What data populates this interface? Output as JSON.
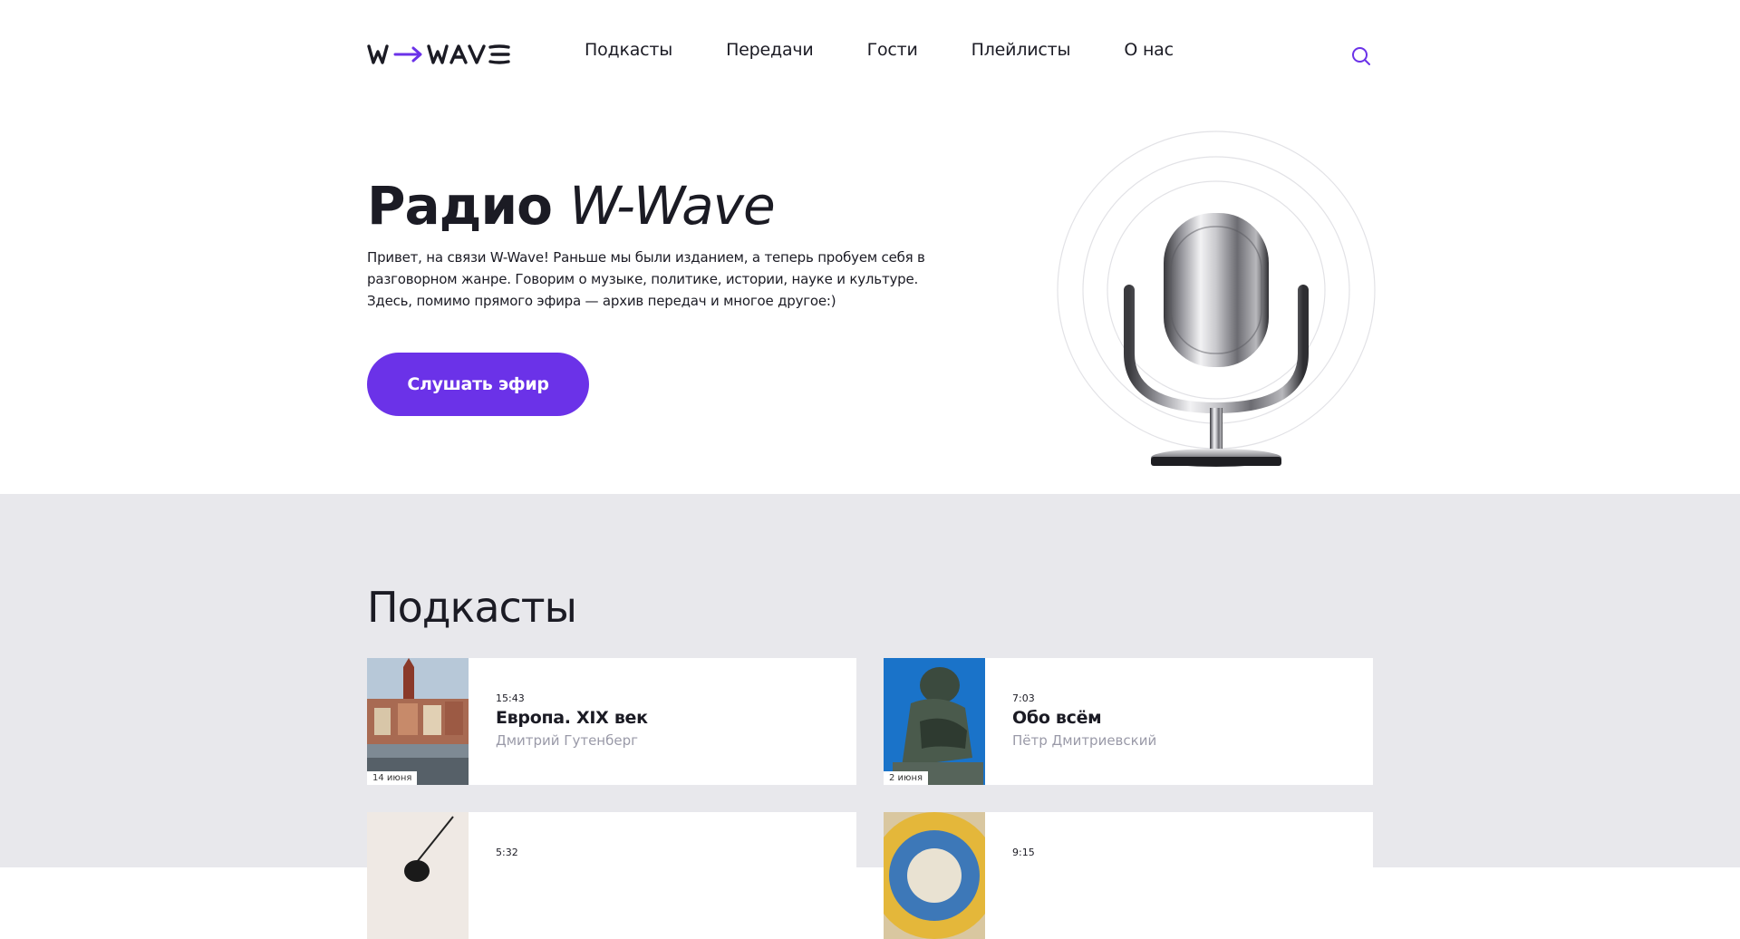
{
  "header": {
    "logo_alt": "W→WAVE",
    "nav": [
      {
        "label": "Подкасты"
      },
      {
        "label": "Передачи"
      },
      {
        "label": "Гости"
      },
      {
        "label": "Плейлисты"
      },
      {
        "label": "О нас"
      }
    ],
    "search_icon": "search-icon"
  },
  "hero": {
    "title_bold": "Радио",
    "title_italic": "W-Wave",
    "text": "Привет, на связи W-Wave! Раньше мы были изданием, а теперь пробуем себя в разговорном жанре. Говорим о музыке, политике, истории, науке и культуре. Здесь, помимо прямого эфира — архив передач и многое другое:)",
    "button_label": "Слушать эфир"
  },
  "podcasts": {
    "title": "Подкасты",
    "items": [
      {
        "time": "15:43",
        "title": "Европа. XIX век",
        "author": "Дмитрий Гутенберг",
        "date": "14 июня"
      },
      {
        "time": "7:03",
        "title": "Обо всём",
        "author": "Пётр Дмитриевский",
        "date": "2 июня"
      },
      {
        "time": "5:32",
        "title": "",
        "author": "",
        "date": ""
      },
      {
        "time": "9:15",
        "title": "",
        "author": "",
        "date": ""
      }
    ]
  },
  "colors": {
    "accent": "#6b32e8",
    "section_bg": "#e8e8ec",
    "muted_text": "#9a9aa8"
  }
}
